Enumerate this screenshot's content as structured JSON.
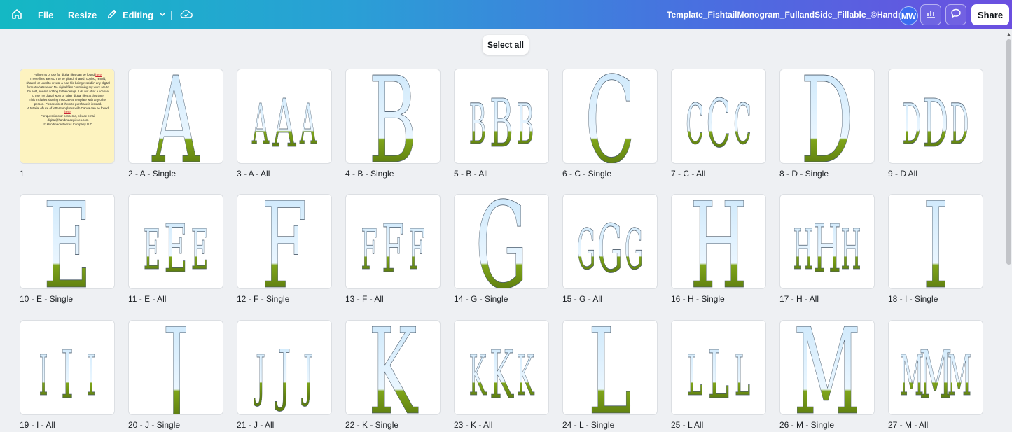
{
  "topbar": {
    "file_label": "File",
    "resize_label": "Resize",
    "editing_label": "Editing",
    "separator": "|",
    "doc_title": "Template_FishtailMonogram_FullandSide_Fillable_©Handm...",
    "avatar_initials": "MW",
    "share_label": "Share",
    "icons": [
      "home-icon",
      "pencil-icon",
      "chevron-down-icon",
      "cloud-sync-icon",
      "insights-icon",
      "comment-icon"
    ]
  },
  "select_all_label": "Select all",
  "pages": [
    {
      "label": "1",
      "kind": "terms"
    },
    {
      "label": "2 - A - Single",
      "letter": "A",
      "kind": "single"
    },
    {
      "label": "3 - A - All",
      "letter": "A",
      "kind": "all"
    },
    {
      "label": "4 - B - Single",
      "letter": "B",
      "kind": "single"
    },
    {
      "label": "5 - B - All",
      "letter": "B",
      "kind": "all"
    },
    {
      "label": "6 - C - Single",
      "letter": "C",
      "kind": "single"
    },
    {
      "label": "7 - C - All",
      "letter": "C",
      "kind": "all"
    },
    {
      "label": "8 - D - Single",
      "letter": "D",
      "kind": "single"
    },
    {
      "label": "9 - D  All",
      "letter": "D",
      "kind": "all"
    },
    {
      "label": "10 - E - Single",
      "letter": "E",
      "kind": "single"
    },
    {
      "label": "11 - E - All",
      "letter": "E",
      "kind": "all"
    },
    {
      "label": "12 - F - Single",
      "letter": "F",
      "kind": "single"
    },
    {
      "label": "13 - F - All",
      "letter": "F",
      "kind": "all"
    },
    {
      "label": "14 - G - Single",
      "letter": "G",
      "kind": "single"
    },
    {
      "label": "15 - G - All",
      "letter": "G",
      "kind": "all"
    },
    {
      "label": "16 - H - Single",
      "letter": "H",
      "kind": "single"
    },
    {
      "label": "17 - H - All",
      "letter": "H",
      "kind": "all"
    },
    {
      "label": "18 - I - Single",
      "letter": "I",
      "kind": "single"
    },
    {
      "label": "19 - I - All",
      "letter": "I",
      "kind": "all"
    },
    {
      "label": "20 - J - Single",
      "letter": "J",
      "kind": "single"
    },
    {
      "label": "21 - J - All",
      "letter": "J",
      "kind": "all"
    },
    {
      "label": "22 - K - Single",
      "letter": "K",
      "kind": "single"
    },
    {
      "label": "23 - K - All",
      "letter": "K",
      "kind": "all"
    },
    {
      "label": "24 - L - Single",
      "letter": "L",
      "kind": "single"
    },
    {
      "label": "25 - L  All",
      "letter": "L",
      "kind": "all"
    },
    {
      "label": "26 - M - Single",
      "letter": "M",
      "kind": "single"
    },
    {
      "label": "27 - M - All",
      "letter": "M",
      "kind": "all"
    }
  ],
  "terms_text": {
    "line1": "Full terms of use for digital files can be found",
    "link1": "here",
    "body": "These files are NOT to be gifted, shared, copied, resold, shared, or used to create a new file being resold in any digital format whatsoever. No digital files containing my work are to be sold, even if adding to the design. I do not offer a license to use my digital work or other digital files at this time.",
    "body2": "This includes sharing this Canva Template with any other person. Please direct them to purchase it instead.",
    "line2": "A tutorial of use of letter templates with Canva can be found",
    "link2": "here",
    "contact": "For questions or concerns, please email digital@handmadepieces.com",
    "copyright": "© Handmade Pieces Company LLC"
  },
  "colors": {
    "sky": "#cfe9fb",
    "grass": "#7fa51a",
    "grass_dark": "#5e7e10",
    "outline": "#4a5a6a"
  }
}
